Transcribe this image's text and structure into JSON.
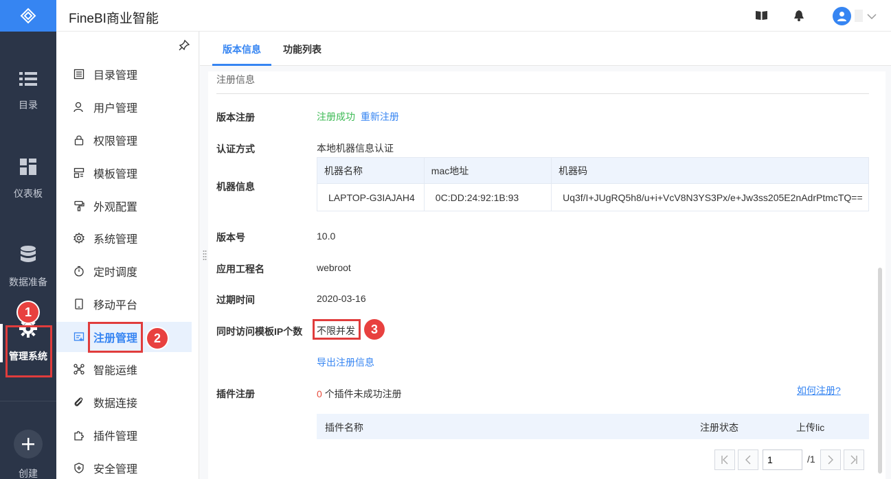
{
  "app": {
    "title": "FineBI商业智能"
  },
  "rail": {
    "items": [
      {
        "label": "目录",
        "icon": "list-icon"
      },
      {
        "label": "仪表板",
        "icon": "dashboard-icon"
      },
      {
        "label": "数据准备",
        "icon": "database-icon"
      },
      {
        "label": "管理系统",
        "icon": "gear-icon"
      }
    ],
    "create_label": "创建"
  },
  "sidebar": {
    "items": [
      {
        "label": "目录管理"
      },
      {
        "label": "用户管理"
      },
      {
        "label": "权限管理"
      },
      {
        "label": "模板管理"
      },
      {
        "label": "外观配置"
      },
      {
        "label": "系统管理"
      },
      {
        "label": "定时调度"
      },
      {
        "label": "移动平台"
      },
      {
        "label": "注册管理"
      },
      {
        "label": "智能运维"
      },
      {
        "label": "数据连接"
      },
      {
        "label": "插件管理"
      },
      {
        "label": "安全管理"
      }
    ],
    "active_index": 8
  },
  "tabs": [
    {
      "label": "版本信息"
    },
    {
      "label": "功能列表"
    }
  ],
  "registration": {
    "section_title": "注册信息",
    "version_reg_label": "版本注册",
    "version_reg_status": "注册成功",
    "reregister_link": "重新注册",
    "auth_method_label": "认证方式",
    "auth_method_value": "本地机器信息认证",
    "machine_info_label": "机器信息",
    "machine_table": {
      "headers": [
        "机器名称",
        "mac地址",
        "机器码"
      ],
      "row": [
        "LAPTOP-G3IAJAH4",
        "0C:DD:24:92:1B:93",
        "Uq3f/I+JUgRQ5h8/u+i+VcV8N3YS3Px/e+Jw3ss205E2nAdrPtmcTQ=="
      ]
    },
    "version_no_label": "版本号",
    "version_no_value": "10.0",
    "app_name_label": "应用工程名",
    "app_name_value": "webroot",
    "expire_label": "过期时间",
    "expire_value": "2020-03-16",
    "concurrent_label": "同时访问模板IP个数",
    "concurrent_value": "不限并发",
    "export_link": "导出注册信息",
    "plugin_reg_label": "插件注册",
    "plugin_fail_count": "0",
    "plugin_fail_text": "个插件未成功注册",
    "how_to_link": "如何注册?",
    "plugin_table_headers": [
      "插件名称",
      "注册状态",
      "上传lic"
    ]
  },
  "pager": {
    "current": "1",
    "total": "/1"
  },
  "annotations": [
    "1",
    "2",
    "3"
  ],
  "colors": {
    "accent": "#3685f2",
    "rail_bg": "#2b3548",
    "success": "#3cba54",
    "highlight": "#e03c3c"
  }
}
